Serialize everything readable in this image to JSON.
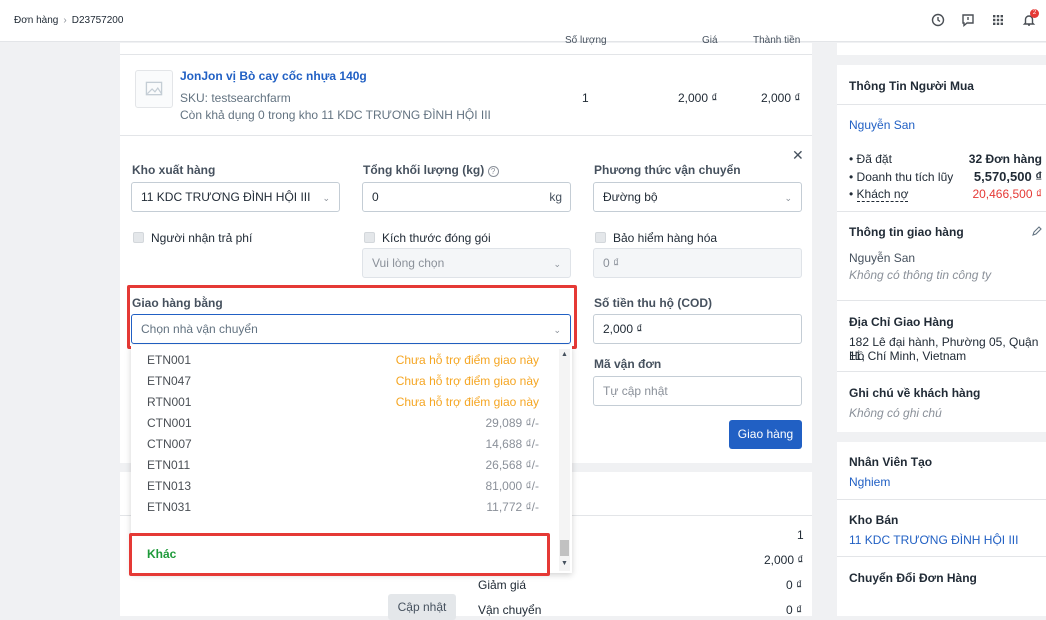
{
  "breadcrumb": {
    "root": "Đơn hàng",
    "current": "D23757200"
  },
  "product": {
    "name": "JonJon vị Bò cay cốc nhựa 140g",
    "sku": "SKU: testsearchfarm",
    "stock_note": "Còn khả dụng 0 trong kho 11 KDC TRƯƠNG ĐÌNH HỘI III",
    "qty": "1",
    "price": "2,000 ₫",
    "total": "2,000 ₫"
  },
  "table_header": {
    "qty": "Số lượng",
    "price": "Giá",
    "total": "Thành tiền"
  },
  "shipping_form": {
    "warehouse_label": "Kho xuất hàng",
    "warehouse_value": "11 KDC TRƯƠNG ĐÌNH HỘI III",
    "weight_label": "Tổng khối lượng (kg)",
    "weight_value": "0",
    "weight_unit": "kg",
    "method_label": "Phương thức vận chuyển",
    "method_value": "Đường bộ",
    "payer_label": "Người nhận trả phí",
    "package_label": "Kích thước đóng gói",
    "package_placeholder": "Vui lòng chọn",
    "insurance_label": "Bảo hiểm hàng hóa",
    "insurance_placeholder": "0 ₫",
    "carrier_label": "Giao hàng bằng",
    "carrier_placeholder": "Chọn nhà vận chuyển",
    "cod_label": "Số tiền thu hộ (COD)",
    "cod_value": "2,000 ₫",
    "tracking_label": "Mã vận đơn",
    "tracking_placeholder": "Tự cập nhật",
    "ship_button": "Giao hàng"
  },
  "carrier_options": [
    {
      "code": "ETN001",
      "value": "Chưa hỗ trợ điểm giao này",
      "warn": true
    },
    {
      "code": "ETN047",
      "value": "Chưa hỗ trợ điểm giao này",
      "warn": true
    },
    {
      "code": "RTN001",
      "value": "Chưa hỗ trợ điểm giao này",
      "warn": true
    },
    {
      "code": "CTN001",
      "value": "29,089 ₫/-",
      "warn": false
    },
    {
      "code": "CTN007",
      "value": "14,688 ₫/-",
      "warn": false
    },
    {
      "code": "ETN011",
      "value": "26,568 ₫/-",
      "warn": false
    },
    {
      "code": "ETN013",
      "value": "81,000 ₫/-",
      "warn": false
    },
    {
      "code": "ETN031",
      "value": "11,772 ₫/-",
      "warn": false
    }
  ],
  "other_option": "Khác",
  "summary": {
    "qty": "1",
    "subtotal": "2,000 ₫",
    "discount_label": "Giảm giá",
    "discount": "0 ₫",
    "shipping_label": "Vận chuyển",
    "shipping": "0 ₫",
    "update_button": "Cập nhật"
  },
  "buyer": {
    "title": "Thông Tin Người Mua",
    "name": "Nguyễn San",
    "orders_label": "Đã đặt",
    "orders": "32 Đơn hàng",
    "revenue_label": "Doanh thu tích lũy",
    "revenue": "5,570,500 ₫",
    "debt_label": "Khách nợ",
    "debt": "20,466,500 ₫"
  },
  "delivery_info": {
    "title": "Thông tin giao hàng",
    "name": "Nguyễn San",
    "company": "Không có thông tin công ty"
  },
  "address": {
    "title": "Địa Chỉ Giao Hàng",
    "line1": "182 Lê đại hành, Phường 05, Quận 11,",
    "line2": "Hồ Chí Minh, Vietnam"
  },
  "note": {
    "title": "Ghi chú về khách hàng",
    "value": "Không có ghi chú"
  },
  "staff": {
    "title": "Nhân Viên Tạo",
    "value": "Nghiem"
  },
  "store": {
    "title": "Kho Bán",
    "value": "11 KDC TRƯƠNG ĐÌNH HỘI III"
  },
  "convert": {
    "title": "Chuyển Đổi Đơn Hàng"
  },
  "notifications": {
    "count": "2"
  },
  "colors": {
    "accent": "#2160c4",
    "warn": "#f5a623",
    "danger": "#e53935",
    "success": "#1e9a3a"
  }
}
